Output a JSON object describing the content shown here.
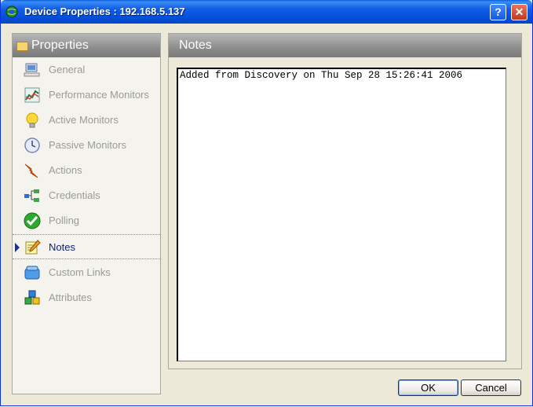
{
  "window": {
    "title": "Device Properties : 192.168.5.137"
  },
  "titlebar": {
    "help_glyph": "?",
    "close_glyph": "✕"
  },
  "sidebar": {
    "header": "Properties",
    "items": [
      {
        "label": "General",
        "icon": "computer-icon"
      },
      {
        "label": "Performance Monitors",
        "icon": "chart-icon"
      },
      {
        "label": "Active Monitors",
        "icon": "lightbulb-icon"
      },
      {
        "label": "Passive Monitors",
        "icon": "clock-icon"
      },
      {
        "label": "Actions",
        "icon": "lightning-icon"
      },
      {
        "label": "Credentials",
        "icon": "network-icon"
      },
      {
        "label": "Polling",
        "icon": "checkmark-icon"
      },
      {
        "label": "Notes",
        "icon": "notepad-icon"
      },
      {
        "label": "Custom Links",
        "icon": "links-icon"
      },
      {
        "label": "Attributes",
        "icon": "blocks-icon"
      }
    ],
    "selected": "Notes"
  },
  "main": {
    "header": "Notes",
    "notes_text": "Added from Discovery on Thu Sep 28 15:26:41 2006"
  },
  "buttons": {
    "ok": "OK",
    "cancel": "Cancel"
  }
}
